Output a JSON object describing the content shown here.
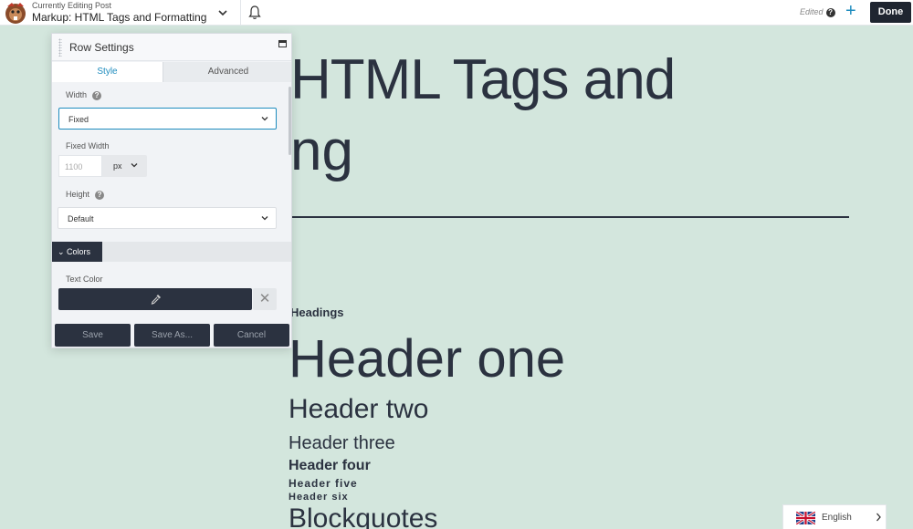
{
  "topbar": {
    "small_label": "Currently Editing Post",
    "post_title": "Markup: HTML Tags and Formatting",
    "status": "Edited",
    "help_glyph": "?",
    "add_glyph": "+",
    "done_label": "Done"
  },
  "page": {
    "title_line1": "HTML Tags and",
    "title_line2": "ng",
    "section_label": "Headings",
    "h1": "Header one",
    "h2": "Header two",
    "h3": "Header three",
    "h4": "Header four",
    "h5": "Header five",
    "h6": "Header six",
    "next_section": "Blockquotes"
  },
  "panel": {
    "title": "Row Settings",
    "tabs": [
      {
        "label": "Style",
        "active": true
      },
      {
        "label": "Advanced",
        "active": false
      }
    ],
    "width_label": "Width",
    "width_value": "Fixed",
    "fixed_width_label": "Fixed Width",
    "fixed_width_placeholder": "1100",
    "fixed_width_unit": "px",
    "height_label": "Height",
    "height_value": "Default",
    "colors_section": "Colors",
    "text_color_label": "Text Color",
    "text_color_value": "#2b3240",
    "clear_glyph": "✕",
    "buttons": {
      "save": "Save",
      "save_as": "Save As...",
      "cancel": "Cancel"
    }
  },
  "language": {
    "label": "English",
    "flag_icon": "uk-flag-icon"
  },
  "colors": {
    "accent": "#1e8cbe",
    "dark": "#2b3240",
    "page_bg": "#d3e6dd"
  }
}
